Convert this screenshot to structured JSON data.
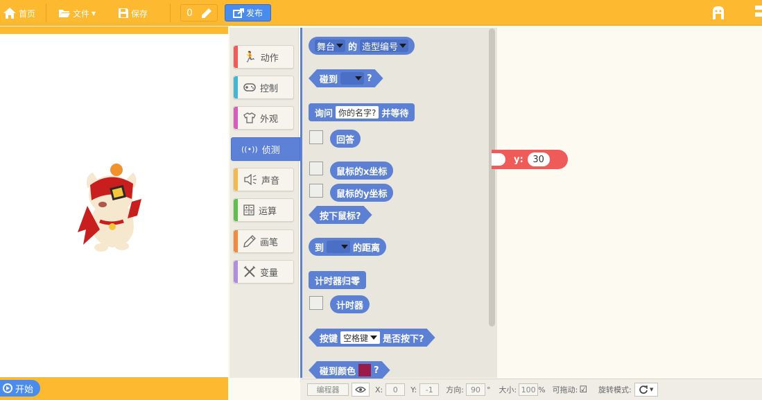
{
  "toolbar": {
    "home_label": "首页",
    "file_label": "文件",
    "save_label": "保存",
    "counter_value": "0",
    "publish_label": "发布"
  },
  "stage": {
    "start_label": "开始"
  },
  "categories": [
    {
      "label": "动作",
      "color": "#ef5b58"
    },
    {
      "label": "控制",
      "color": "#3fb7d6"
    },
    {
      "label": "外观",
      "color": "#d65cc0"
    },
    {
      "label": "侦测",
      "color": "#5c81d6"
    },
    {
      "label": "声音",
      "color": "#f5b84a"
    },
    {
      "label": "运算",
      "color": "#5dbf4d"
    },
    {
      "label": "画笔",
      "color": "#f08a3c"
    },
    {
      "label": "变量",
      "color": "#b18de2"
    }
  ],
  "blocks": {
    "b1_stage": "舞台",
    "b1_of": "的",
    "b1_prop": "造型编号",
    "b2_touch": "碰到",
    "b2_q": "?",
    "b3_ask": "询问",
    "b3_default": "你的名字?",
    "b3_wait": "并等待",
    "b4_answer": "回答",
    "b5_mousex": "鼠标的x坐标",
    "b6_mousey": "鼠标的y坐标",
    "b7_mousedown": "按下鼠标?",
    "b8_to": "到",
    "b8_distance": "的距离",
    "b9_reset": "计时器归零",
    "b10_timer": "计时器",
    "b11_key": "按键",
    "b11_space": "空格键",
    "b11_pressed": "是否按下?",
    "b12_touchcolor": "碰到颜色",
    "b12_q": "?",
    "touch_color": "#9a1b4a"
  },
  "script": {
    "y_label": "y:",
    "y_value": "30"
  },
  "statusbar": {
    "editor_label": "编程器",
    "x_label": "X:",
    "x_value": "0",
    "y_label": "Y:",
    "y_value": "-1",
    "dir_label": "方向:",
    "dir_value": "90",
    "deg": "°",
    "size_label": "大小:",
    "size_value": "100",
    "size_unit": "%",
    "drag_label": "可拖动:",
    "drag_check": "☑",
    "rot_label": "旋转模式:"
  }
}
